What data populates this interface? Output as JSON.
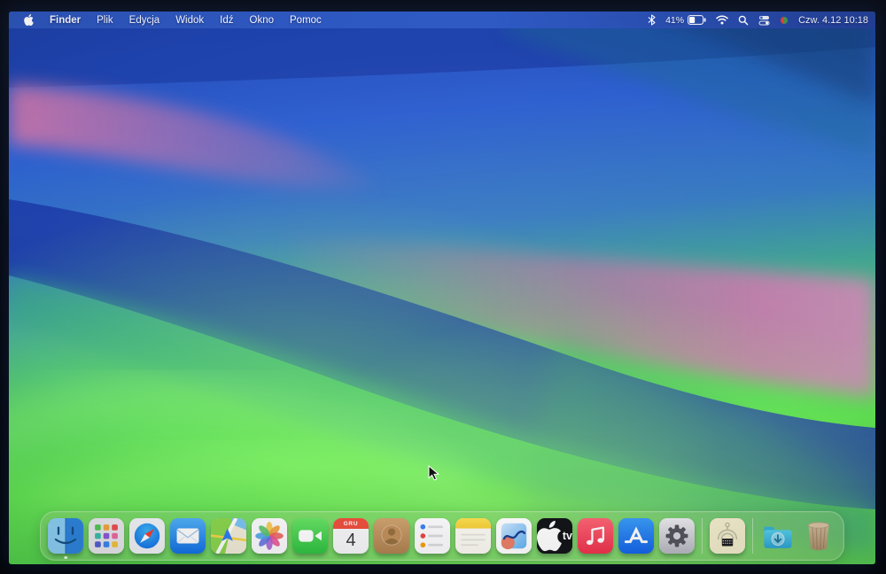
{
  "menu_bar": {
    "apple_icon": "apple-logo",
    "items": [
      {
        "label": "Finder"
      },
      {
        "label": "Plik"
      },
      {
        "label": "Edycja"
      },
      {
        "label": "Widok"
      },
      {
        "label": "Idź"
      },
      {
        "label": "Okno"
      },
      {
        "label": "Pomoc"
      }
    ],
    "status": {
      "icons": [
        "bluetooth-icon",
        "battery-indicator",
        "wifi-icon",
        "spotlight-search-icon",
        "control-center-icon",
        "menu-bar-extra-icon"
      ],
      "battery_percent": "41%",
      "battery_level": 0.41,
      "clock": "Czw. 4.12  10:18"
    }
  },
  "dock": {
    "items": [
      {
        "icon": "finder-icon",
        "running": true
      },
      {
        "icon": "launchpad-icon"
      },
      {
        "icon": "safari-icon"
      },
      {
        "icon": "mail-icon"
      },
      {
        "icon": "maps-icon"
      },
      {
        "icon": "photos-icon"
      },
      {
        "icon": "facetime-icon"
      },
      {
        "icon": "calendar-icon",
        "month_label": "GRU",
        "day_label": "4"
      },
      {
        "icon": "contacts-icon"
      },
      {
        "icon": "reminders-icon"
      },
      {
        "icon": "notes-icon"
      },
      {
        "icon": "freeform-icon"
      },
      {
        "icon": "apple-tv-icon",
        "label": "tv"
      },
      {
        "icon": "music-icon"
      },
      {
        "icon": "app-store-icon"
      },
      {
        "icon": "system-settings-icon"
      },
      {
        "icon": "unarchiver-icon"
      },
      {
        "icon": "downloads-folder-icon"
      },
      {
        "icon": "trash-icon"
      }
    ]
  },
  "wallpaper": {
    "colors": {
      "top_blue": "#2a5bd0",
      "navy_band": "#1c3da8",
      "pink_band": "#bd74a6",
      "teal": "#2f9c86",
      "green": "#4fd04c"
    }
  }
}
